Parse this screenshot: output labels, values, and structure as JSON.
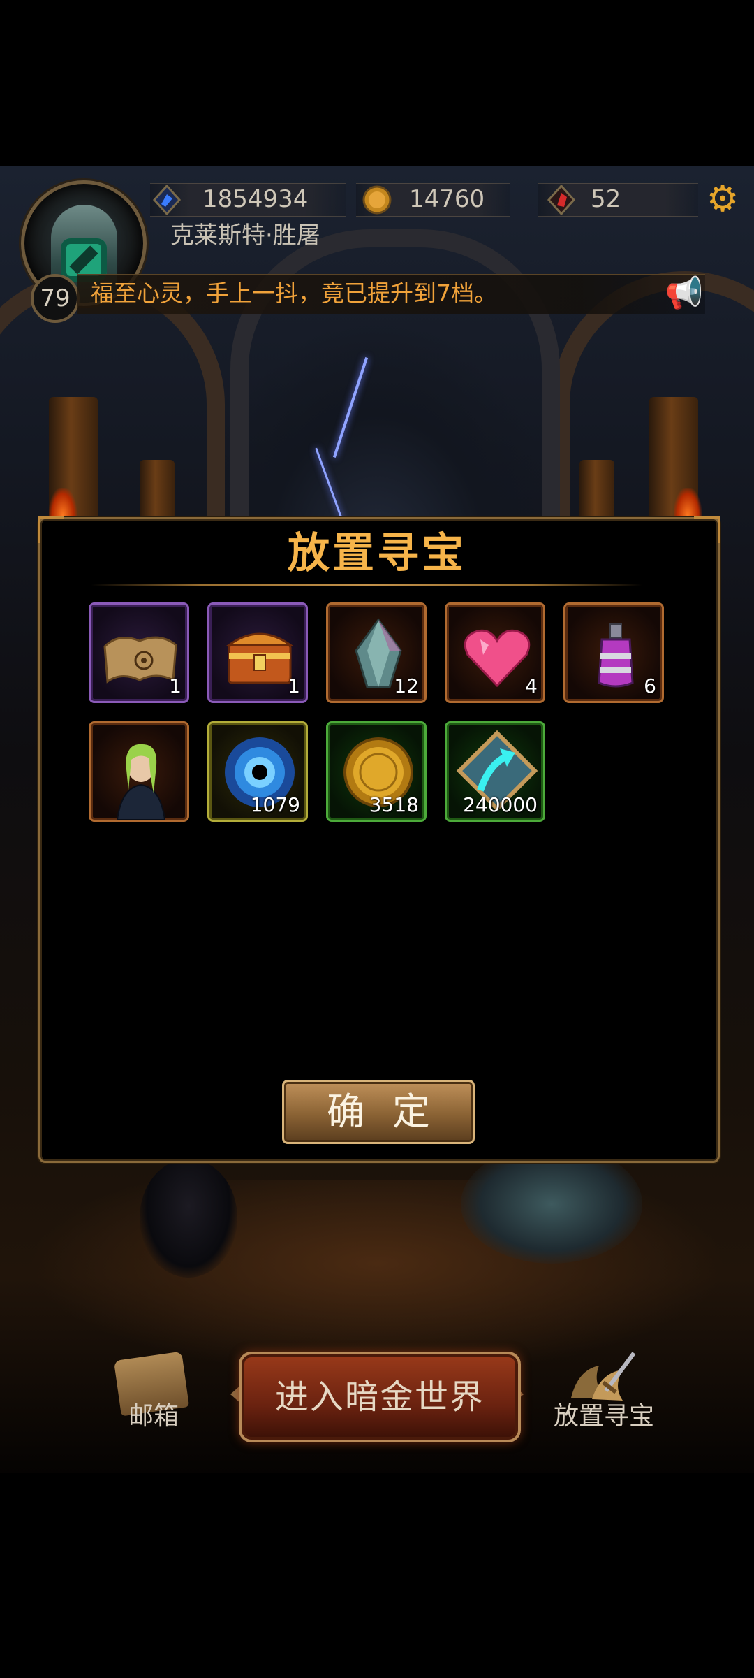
{
  "hud": {
    "player_name": "克莱斯特·胜屠",
    "level": "79",
    "resources": [
      {
        "icon": "blue-crystal-icon",
        "value": "1854934"
      },
      {
        "icon": "gold-coin-icon",
        "value": "14760"
      },
      {
        "icon": "red-gem-icon",
        "value": "52"
      }
    ],
    "settings_icon": "gear-icon",
    "marquee_text": "福至心灵，手上一抖，竟已提升到7档。",
    "speaker_icon": "megaphone-icon"
  },
  "dialog": {
    "title": "放置寻宝",
    "items": [
      {
        "icon": "treasure-map-icon",
        "count": "1",
        "rarity": "purple"
      },
      {
        "icon": "treasure-chest-icon",
        "count": "1",
        "rarity": "purple"
      },
      {
        "icon": "crystal-shard-icon",
        "count": "12",
        "rarity": "orange"
      },
      {
        "icon": "pink-heart-gem-icon",
        "count": "4",
        "rarity": "orange"
      },
      {
        "icon": "purple-potion-icon",
        "count": "6",
        "rarity": "orange"
      },
      {
        "icon": "hero-portrait-icon",
        "count": "",
        "rarity": "orange"
      },
      {
        "icon": "blue-portal-orb-icon",
        "count": "1079",
        "rarity": "yellow"
      },
      {
        "icon": "gold-coin-icon",
        "count": "3518",
        "rarity": "green"
      },
      {
        "icon": "experience-arrow-icon",
        "count": "240000",
        "rarity": "green"
      }
    ],
    "confirm_label": "确定"
  },
  "bottom_nav": {
    "mail_label": "邮箱",
    "enter_label": "进入暗金世界",
    "idle_treasure_label": "放置寻宝"
  },
  "colors": {
    "title_gold": "#f6b44a",
    "marquee_orange": "#f0a23a",
    "rarity_purple": "#8a5ab8",
    "rarity_orange": "#b06a30",
    "rarity_yellow": "#b3ad3a",
    "rarity_green": "#4caa3a"
  }
}
